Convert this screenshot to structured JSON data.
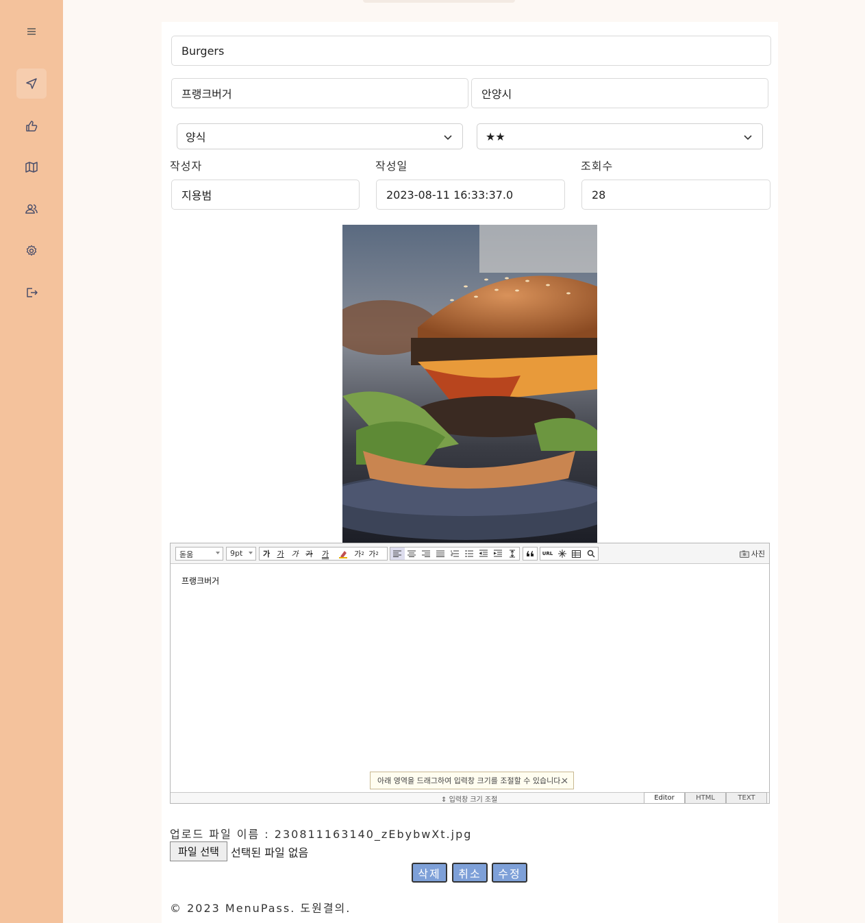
{
  "sidebar": {
    "items": [
      {
        "name": "menu-icon"
      },
      {
        "name": "navigation-arrow-icon",
        "active": true
      },
      {
        "name": "thumbs-up-icon"
      },
      {
        "name": "map-icon"
      },
      {
        "name": "users-icon"
      },
      {
        "name": "gear-icon"
      },
      {
        "name": "logout-icon"
      }
    ],
    "color": "#f4c29c"
  },
  "form": {
    "title": "Burgers",
    "store_name": "프랭크버거",
    "location": "안양시",
    "category": "양식",
    "rating": "★★",
    "author_label": "작성자",
    "date_label": "작성일",
    "views_label": "조회수",
    "author": "지용범",
    "date": "2023-08-11 16:33:37.0",
    "views": "28"
  },
  "editor": {
    "font": "돋움",
    "size": "9pt",
    "photo_button": "사진",
    "content": "프랭크버거",
    "tooltip": "아래 영역을 드래그하여 입력창 크기를 조절할 수 있습니다.",
    "resize_label": "입력창 크기 조절",
    "modes": [
      "Editor",
      "HTML",
      "TEXT"
    ],
    "url_label": "URL",
    "format_buttons": [
      "가",
      "가",
      "가",
      "가",
      "가"
    ],
    "super_label": "가",
    "sub_label": "가"
  },
  "upload": {
    "label": "업로드 파일 이름 : 230811163140_zEbybwXt.jpg",
    "choose_button": "파일 선택",
    "no_file": "선택된 파일 없음"
  },
  "actions": {
    "delete": "삭제",
    "cancel": "취소",
    "edit": "수정",
    "color": "#7ea0d8"
  },
  "footer": {
    "copyright": "© 2023 MenuPass. 도원결의."
  }
}
